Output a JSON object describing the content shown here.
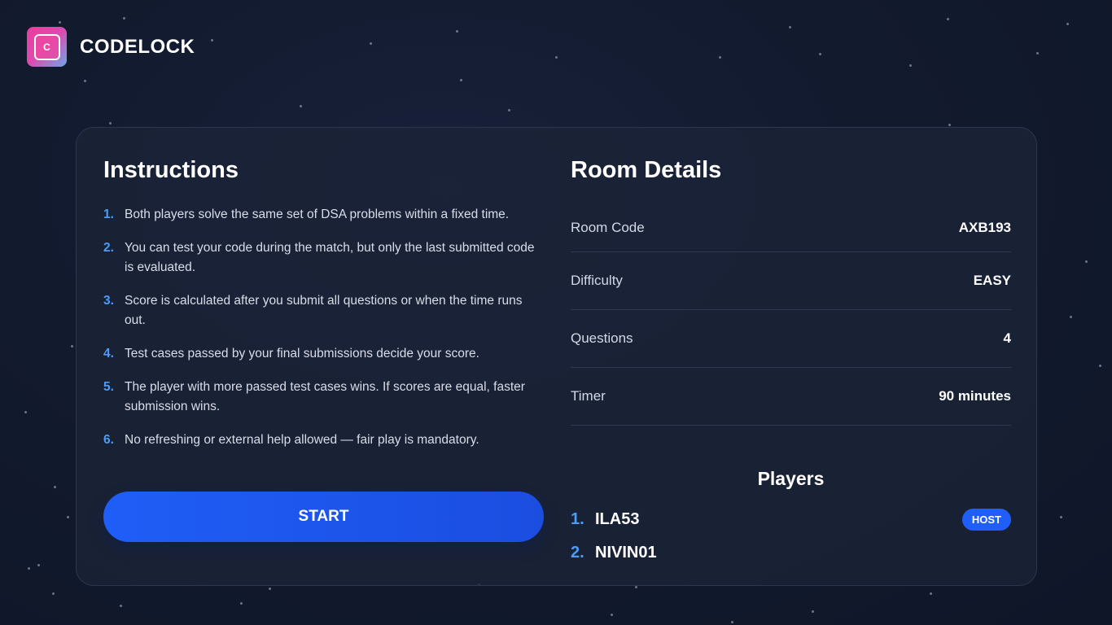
{
  "app": {
    "name": "CODELOCK",
    "logo_letter": "C"
  },
  "instructions": {
    "title": "Instructions",
    "items": [
      {
        "num": "1.",
        "text": "Both players solve the same set of DSA problems within a fixed time."
      },
      {
        "num": "2.",
        "text": "You can test your code during the match, but only the last submitted code is evaluated."
      },
      {
        "num": "3.",
        "text": "Score is calculated after you submit all questions or when the time runs out."
      },
      {
        "num": "4.",
        "text": "Test cases passed by your final submissions decide your score."
      },
      {
        "num": "5.",
        "text": "The player with more passed test cases wins. If scores are equal, faster submission wins."
      },
      {
        "num": "6.",
        "text": "No refreshing or external help allowed — fair play is mandatory."
      }
    ],
    "start_label": "START"
  },
  "room": {
    "title": "Room Details",
    "details": [
      {
        "label": "Room Code",
        "value": "AXB193"
      },
      {
        "label": "Difficulty",
        "value": "EASY"
      },
      {
        "label": "Questions",
        "value": "4"
      },
      {
        "label": "Timer",
        "value": "90 minutes"
      }
    ],
    "players_title": "Players",
    "players": [
      {
        "num": "1.",
        "name": "ILA53",
        "badge": "HOST"
      },
      {
        "num": "2.",
        "name": "NIVIN01",
        "badge": ""
      }
    ]
  },
  "colors": {
    "accent": "#1f5ef7",
    "number_blue": "#4d9cf8",
    "background": "#121a2e",
    "card": "#1b2337"
  }
}
